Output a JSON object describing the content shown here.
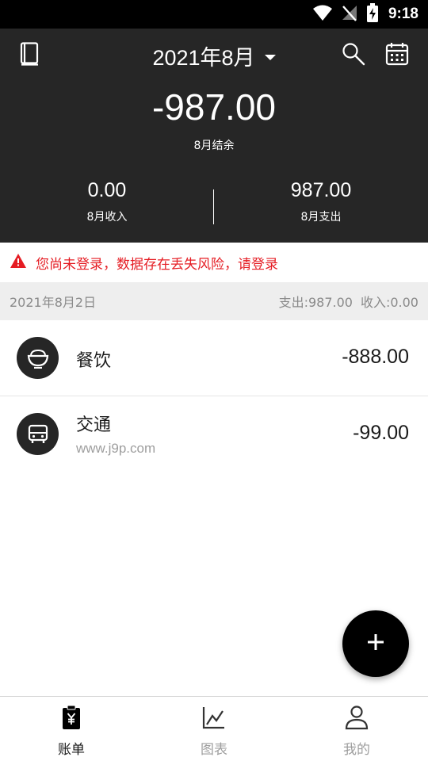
{
  "status_bar": {
    "time": "9:18",
    "icons": [
      "wifi-icon",
      "signal-off-icon",
      "battery-charging-icon"
    ]
  },
  "header": {
    "book_icon": "book-icon",
    "month": "2021年8月",
    "search_icon": "search-icon",
    "calendar_icon": "calendar-icon",
    "balance": "-987.00",
    "balance_label": "8月结余",
    "income_value": "0.00",
    "income_label": "8月收入",
    "expense_value": "987.00",
    "expense_label": "8月支出"
  },
  "warning": {
    "icon": "warning-icon",
    "text": "您尚未登录，数据存在丢失风险，请登录"
  },
  "day_group": {
    "date": "2021年8月2日",
    "expense_summary": "支出:987.00",
    "income_summary": "收入:0.00"
  },
  "transactions": [
    {
      "category": "餐饮",
      "icon": "rice-bowl-icon",
      "note": "",
      "amount": "-888.00"
    },
    {
      "category": "交通",
      "icon": "bus-icon",
      "note": "www.j9p.com",
      "amount": "-99.00"
    }
  ],
  "fab": {
    "icon": "plus-icon"
  },
  "bottom_nav": {
    "tabs": [
      {
        "label": "账单",
        "icon": "bill-icon",
        "active": true
      },
      {
        "label": "图表",
        "icon": "chart-icon",
        "active": false
      },
      {
        "label": "我的",
        "icon": "person-icon",
        "active": false
      }
    ]
  },
  "colors": {
    "header_bg": "#262626",
    "warning_red": "#e51c23",
    "date_row_bg": "#eeeeee"
  }
}
